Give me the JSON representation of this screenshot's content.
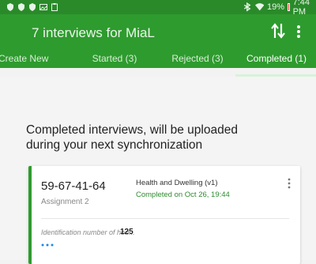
{
  "status_bar": {
    "time": "7:44 PM",
    "battery": "19%",
    "icons": [
      "shield-icon",
      "shield-icon",
      "shield-icon",
      "image-icon",
      "clipboard-icon",
      "bluetooth-icon",
      "wifi-icon",
      "battery-icon"
    ]
  },
  "app_bar": {
    "title": "7 interviews for MiaL",
    "sync_icon": "sync-icon",
    "menu_icon": "more-vert-icon"
  },
  "tabs": [
    {
      "label": "Create New"
    },
    {
      "label": "Started (3)"
    },
    {
      "label": "Rejected (3)"
    },
    {
      "label": "Completed (1)",
      "active": true
    }
  ],
  "main": {
    "info": "Completed interviews, will be uploaded during your next synchronization"
  },
  "card": {
    "id": "59-67-41-64",
    "assignment": "Assignment 2",
    "questionnaire": "Health and Dwelling (v1)",
    "status": "Completed on Oct 26, 19:44",
    "field_label": "Identification number of hou...",
    "field_value": "125",
    "more": "..."
  },
  "colors": {
    "primary": "#2e9b2e",
    "status_bar": "#2a8a2a",
    "completed_text": "#2e8b2e",
    "battery_low": "#e53935"
  }
}
